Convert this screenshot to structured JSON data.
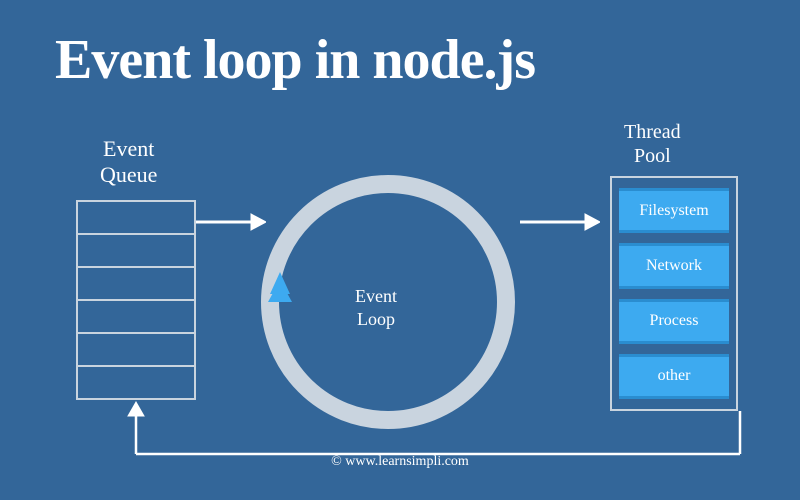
{
  "title": "Event loop in node.js",
  "eventQueue": {
    "label": "Event\nQueue",
    "rowCount": 6
  },
  "eventLoop": {
    "label": "Event\nLoop"
  },
  "threadPool": {
    "label": "Thread\nPool",
    "items": [
      "Filesystem",
      "Network",
      "Process",
      "other"
    ]
  },
  "copyright": "© www.learnsimpli.com"
}
